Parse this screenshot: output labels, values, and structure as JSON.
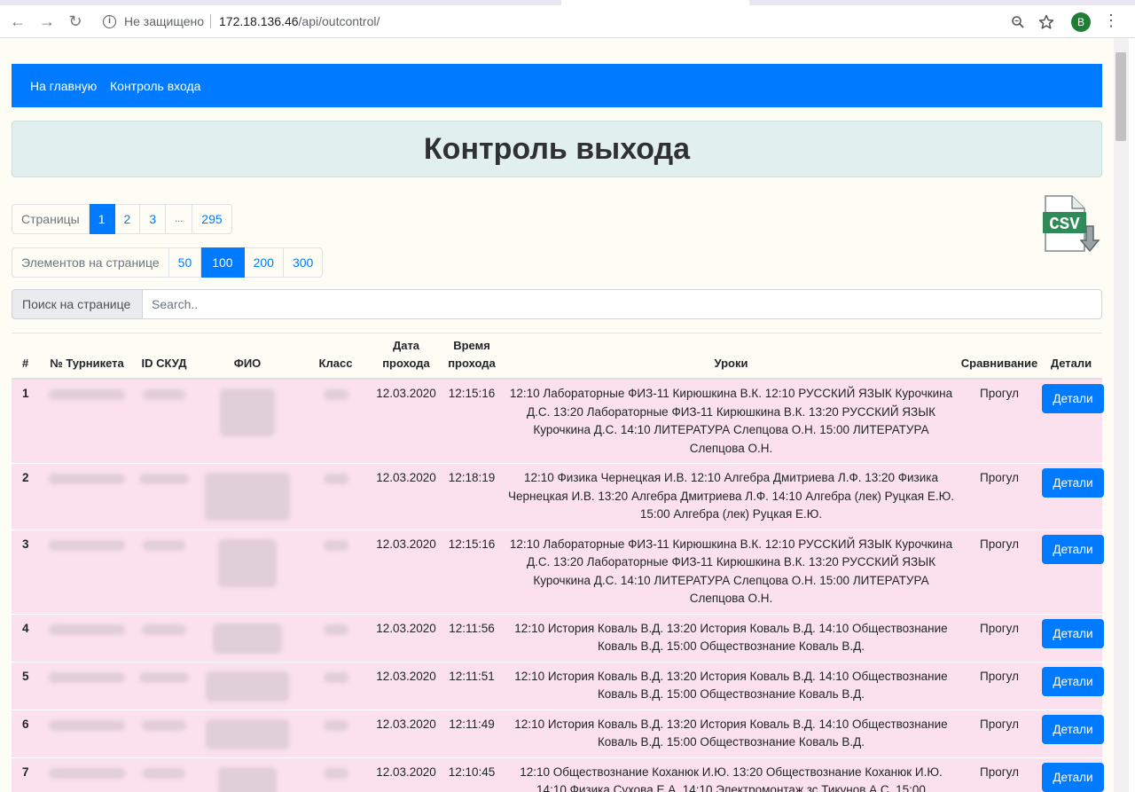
{
  "browser": {
    "security_label": "Не защищено",
    "url_host": "172.18.136.46",
    "url_path": "/api/outcontrol/",
    "profile_initial": "В"
  },
  "navbar": {
    "home": "На главную",
    "entry_control": "Контроль входа"
  },
  "page_title": "Контроль выхода",
  "pagination": {
    "label": "Страницы",
    "pages": [
      "1",
      "2",
      "3",
      "...",
      "295"
    ],
    "active_page": "1"
  },
  "page_size": {
    "label": "Элементов на странице",
    "options": [
      "50",
      "100",
      "200",
      "300"
    ],
    "active": "100"
  },
  "search": {
    "label": "Поиск на странице",
    "placeholder": "Search.."
  },
  "csv_icon_label": "CSV",
  "table": {
    "headers": {
      "num": "#",
      "turnstile": "№ Турникета",
      "skud_id": "ID СКУД",
      "fio": "ФИО",
      "class": "Класс",
      "date": "Дата прохода",
      "time": "Время прохода",
      "lessons": "Уроки",
      "comparison": "Сравнивание",
      "details": "Детали"
    },
    "rows": [
      {
        "num": "1",
        "date": "12.03.2020",
        "time": "12:15:16",
        "lessons": "12:10 Лабораторные ФИЗ-11 Кирюшкина В.К. 12:10 РУССКИЙ ЯЗЫК Курочкина Д.С. 13:20 Лабораторные ФИЗ-11 Кирюшкина В.К. 13:20 РУССКИЙ ЯЗЫК Курочкина Д.С. 14:10 ЛИТЕРАТУРА Слепцова О.Н. 15:00 ЛИТЕРАТУРА Слепцова О.Н.",
        "comparison": "Прогул",
        "details": "Детали"
      },
      {
        "num": "2",
        "date": "12.03.2020",
        "time": "12:18:19",
        "lessons": "12:10 Физика Чернецкая И.В. 12:10 Алгебра Дмитриева Л.Ф. 13:20 Физика Чернецкая И.В. 13:20 Алгебра Дмитриева Л.Ф. 14:10 Алгебра (лек) Руцкая Е.Ю. 15:00 Алгебра (лек) Руцкая Е.Ю.",
        "comparison": "Прогул",
        "details": "Детали"
      },
      {
        "num": "3",
        "date": "12.03.2020",
        "time": "12:15:16",
        "lessons": "12:10 Лабораторные ФИЗ-11 Кирюшкина В.К. 12:10 РУССКИЙ ЯЗЫК Курочкина Д.С. 13:20 Лабораторные ФИЗ-11 Кирюшкина В.К. 13:20 РУССКИЙ ЯЗЫК Курочкина Д.С. 14:10 ЛИТЕРАТУРА Слепцова О.Н. 15:00 ЛИТЕРАТУРА Слепцова О.Н.",
        "comparison": "Прогул",
        "details": "Детали"
      },
      {
        "num": "4",
        "date": "12.03.2020",
        "time": "12:11:56",
        "lessons": "12:10 История Коваль В.Д. 13:20 История Коваль В.Д. 14:10 Обществознание Коваль В.Д. 15:00 Обществознание Коваль В.Д.",
        "comparison": "Прогул",
        "details": "Детали"
      },
      {
        "num": "5",
        "date": "12.03.2020",
        "time": "12:11:51",
        "lessons": "12:10 История Коваль В.Д. 13:20 История Коваль В.Д. 14:10 Обществознание Коваль В.Д. 15:00 Обществознание Коваль В.Д.",
        "comparison": "Прогул",
        "details": "Детали"
      },
      {
        "num": "6",
        "date": "12.03.2020",
        "time": "12:11:49",
        "lessons": "12:10 История Коваль В.Д. 13:20 История Коваль В.Д. 14:10 Обществознание Коваль В.Д. 15:00 Обществознание Коваль В.Д.",
        "comparison": "Прогул",
        "details": "Детали"
      },
      {
        "num": "7",
        "date": "12.03.2020",
        "time": "12:10:45",
        "lessons": "12:10 Обществознание Коханюк И.Ю. 13:20 Обществознание Коханюк И.Ю. 14:10 Физика Сухова Е.А. 14:10 Электромонтаж зс Тикунов А.С. 15:00",
        "comparison": "Прогул",
        "details": "Детали"
      }
    ]
  },
  "colors": {
    "primary": "#007bff",
    "row_highlight": "#fbe0ee",
    "jumbotron": "#e2efef",
    "page_background": "#fdfdf5"
  }
}
